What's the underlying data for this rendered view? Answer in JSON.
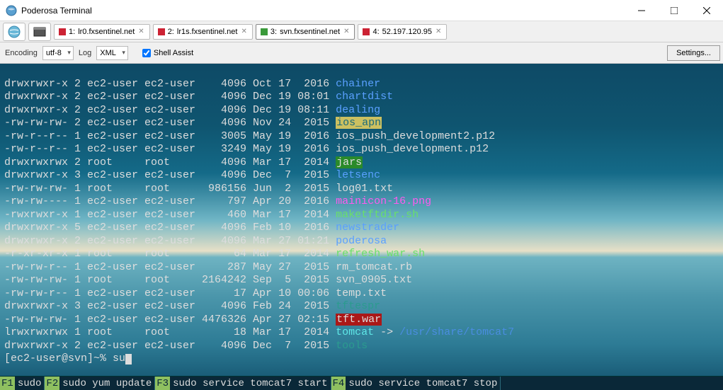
{
  "title": "Poderosa Terminal",
  "tabs": [
    {
      "num": "1",
      "label": "lr0.fxsentinel.net",
      "color": "red",
      "active": false
    },
    {
      "num": "2",
      "label": "lr1s.fxsentinel.net",
      "color": "red",
      "active": false
    },
    {
      "num": "3",
      "label": "svn.fxsentinel.net",
      "color": "green",
      "active": true
    },
    {
      "num": "4",
      "label": "52.197.120.95",
      "color": "red",
      "active": false
    }
  ],
  "toolbar": {
    "encoding_label": "Encoding",
    "encoding_value": "utf-8",
    "log_label": "Log",
    "log_value": "XML",
    "shell_assist": "Shell Assist",
    "settings": "Settings..."
  },
  "listing": [
    {
      "perm": "drwxrwxr-x",
      "n": "2",
      "owner": "ec2-user",
      "group": "ec2-user",
      "size": "4096",
      "mon": "Oct",
      "day": "17",
      "ty": " 2016",
      "name": "chainer",
      "cls": "c-blue"
    },
    {
      "perm": "drwxrwxr-x",
      "n": "2",
      "owner": "ec2-user",
      "group": "ec2-user",
      "size": "4096",
      "mon": "Dec",
      "day": "19",
      "ty": "08:01",
      "name": "chartdist",
      "cls": "c-blue"
    },
    {
      "perm": "drwxrwxr-x",
      "n": "2",
      "owner": "ec2-user",
      "group": "ec2-user",
      "size": "4096",
      "mon": "Dec",
      "day": "19",
      "ty": "08:11",
      "name": "dealing",
      "cls": "c-blue"
    },
    {
      "perm": "-rw-rw-rw-",
      "n": "2",
      "owner": "ec2-user",
      "group": "ec2-user",
      "size": "4096",
      "mon": "Nov",
      "day": "24",
      "ty": " 2015",
      "name": "ios_apn",
      "cls": "bg-ylw"
    },
    {
      "perm": "-rw-r--r--",
      "n": "1",
      "owner": "ec2-user",
      "group": "ec2-user",
      "size": "3005",
      "mon": "May",
      "day": "19",
      "ty": " 2016",
      "name": "ios_push_development2.p12",
      "cls": ""
    },
    {
      "perm": "-rw-r--r--",
      "n": "1",
      "owner": "ec2-user",
      "group": "ec2-user",
      "size": "3249",
      "mon": "May",
      "day": "19",
      "ty": " 2016",
      "name": "ios_push_development.p12",
      "cls": ""
    },
    {
      "perm": "drwxrwxrwx",
      "n": "2",
      "owner": "root",
      "group": "root",
      "size": "4096",
      "mon": "Mar",
      "day": "17",
      "ty": " 2014",
      "name": "jars",
      "cls": "bg-green"
    },
    {
      "perm": "drwxrwxr-x",
      "n": "3",
      "owner": "ec2-user",
      "group": "ec2-user",
      "size": "4096",
      "mon": "Dec",
      "day": " 7",
      "ty": " 2015",
      "name": "letsenc",
      "cls": "c-blue"
    },
    {
      "perm": "-rw-rw-rw-",
      "n": "1",
      "owner": "root",
      "group": "root",
      "size": "986156",
      "mon": "Jun",
      "day": " 2",
      "ty": " 2015",
      "name": "log01.txt",
      "cls": ""
    },
    {
      "perm": "-rw-rw----",
      "n": "1",
      "owner": "ec2-user",
      "group": "ec2-user",
      "size": "797",
      "mon": "Apr",
      "day": "20",
      "ty": " 2016",
      "name": "mainicon-16.png",
      "cls": "c-magenta"
    },
    {
      "perm": "-rwxrwxr-x",
      "n": "1",
      "owner": "ec2-user",
      "group": "ec2-user",
      "size": "460",
      "mon": "Mar",
      "day": "17",
      "ty": " 2014",
      "name": "maketftdir.sh",
      "cls": "c-green"
    },
    {
      "perm": "drwxrwxr-x",
      "n": "5",
      "owner": "ec2-user",
      "group": "ec2-user",
      "size": "4096",
      "mon": "Feb",
      "day": "10",
      "ty": " 2016",
      "name": "newstrader",
      "cls": "c-blue"
    },
    {
      "perm": "drwxrwxr-x",
      "n": "2",
      "owner": "ec2-user",
      "group": "ec2-user",
      "size": "4096",
      "mon": "Mar",
      "day": "27",
      "ty": "01:21",
      "name": "poderosa",
      "cls": "c-blue"
    },
    {
      "perm": "-r-xr-xr-x",
      "n": "1",
      "owner": "root",
      "group": "root",
      "size": "64",
      "mon": "Mar",
      "day": "17",
      "ty": " 2014",
      "name": "refresh_war.sh",
      "cls": "c-green"
    },
    {
      "perm": "-rw-rw-r--",
      "n": "1",
      "owner": "ec2-user",
      "group": "ec2-user",
      "size": "287",
      "mon": "May",
      "day": "27",
      "ty": " 2015",
      "name": "rm_tomcat.rb",
      "cls": ""
    },
    {
      "perm": "-rw-rw-rw-",
      "n": "1",
      "owner": "root",
      "group": "root",
      "size": "2164242",
      "mon": "Sep",
      "day": " 5",
      "ty": " 2015",
      "name": "svn_0905.txt",
      "cls": ""
    },
    {
      "perm": "-rw-rw-r--",
      "n": "1",
      "owner": "ec2-user",
      "group": "ec2-user",
      "size": "17",
      "mon": "Apr",
      "day": "10",
      "ty": "00:06",
      "name": "temp.txt",
      "cls": ""
    },
    {
      "perm": "drwxrwxr-x",
      "n": "3",
      "owner": "ec2-user",
      "group": "ec2-user",
      "size": "4096",
      "mon": "Feb",
      "day": "24",
      "ty": " 2015",
      "name": "tftespr",
      "cls": "c-teal"
    },
    {
      "perm": "-rw-rw-rw-",
      "n": "1",
      "owner": "ec2-user",
      "group": "ec2-user",
      "size": "4476326",
      "mon": "Apr",
      "day": "27",
      "ty": "02:15",
      "name": "tft.war",
      "cls": "bg-red"
    },
    {
      "perm": "lrwxrwxrwx",
      "n": "1",
      "owner": "root",
      "group": "root",
      "size": "18",
      "mon": "Mar",
      "day": "17",
      "ty": " 2014",
      "name": "tomcat",
      "cls": "c-cyan",
      "link": " -> ",
      "link_target": "/usr/share/tomcat7",
      "link_cls": "c-link"
    },
    {
      "perm": "drwxrwxr-x",
      "n": "2",
      "owner": "ec2-user",
      "group": "ec2-user",
      "size": "4096",
      "mon": "Dec",
      "day": " 7",
      "ty": " 2015",
      "name": "tools",
      "cls": "c-teal"
    }
  ],
  "prompt": {
    "text": "[ec2-user@svn]~% ",
    "input": "su"
  },
  "fkeys": [
    {
      "key": "F1",
      "label": "sudo"
    },
    {
      "key": "F2",
      "label": "sudo yum update"
    },
    {
      "key": "F3",
      "label": "sudo service tomcat7 start"
    },
    {
      "key": "F4",
      "label": "sudo service tomcat7 stop"
    }
  ]
}
